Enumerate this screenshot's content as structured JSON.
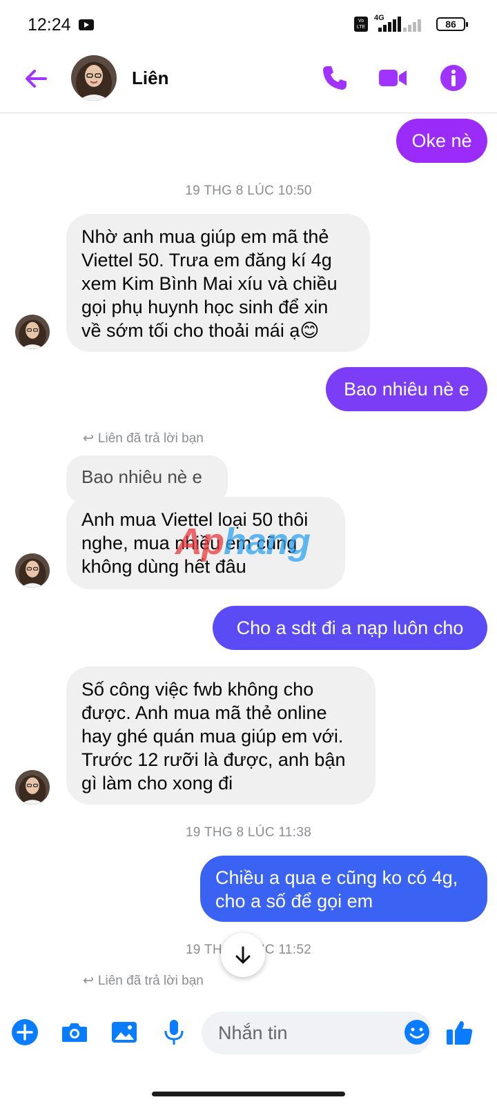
{
  "status_bar": {
    "time": "12:24",
    "network": "4G",
    "volte": "Vo LTE",
    "battery": "86"
  },
  "header": {
    "contact_name": "Liên",
    "accent_color": "#a033ff"
  },
  "messages": [
    {
      "id": "m1",
      "direction": "outgoing",
      "text": "Oke nè"
    },
    {
      "id": "ts1",
      "type": "timestamp",
      "text": "19 THG 8 LÚC 10:50"
    },
    {
      "id": "m2",
      "direction": "incoming",
      "lines": [
        "Nhờ anh mua giúp em mã thẻ",
        "Viettel 50. Trưa em đăng kí 4g",
        "xem Kim Bình Mai xíu và chiều",
        "gọi phụ huynh học sinh để xin",
        "về sớm tối cho thoải mái ạ😊"
      ]
    },
    {
      "id": "m3",
      "direction": "outgoing",
      "text": "Bao nhiêu nè e"
    },
    {
      "id": "r1",
      "type": "reply_note",
      "text": "Liên đã trả lời bạn"
    },
    {
      "id": "q1",
      "type": "quoted",
      "text": "Bao nhiêu nè e"
    },
    {
      "id": "m4",
      "direction": "incoming",
      "lines": [
        "Anh mua Viettel loại 50 thôi",
        "nghe, mua nhiều em cũng",
        "không dùng hết đâu"
      ]
    },
    {
      "id": "m5",
      "direction": "outgoing",
      "text": "Cho a sdt đi a nạp luôn cho"
    },
    {
      "id": "m6",
      "direction": "incoming",
      "lines": [
        "Số công việc fwb không cho",
        "được. Anh mua mã thẻ online",
        "hay ghé quán mua giúp em với.",
        "Trước 12 rưỡi là được, anh bận",
        "gì làm cho xong đi"
      ]
    },
    {
      "id": "ts2",
      "type": "timestamp",
      "text": "19 THG 8 LÚC 11:38"
    },
    {
      "id": "m7",
      "direction": "outgoing",
      "lines": [
        "Chiều a qua e cũng ko có 4g,",
        "cho a số để gọi em"
      ]
    },
    {
      "id": "ts3",
      "type": "timestamp",
      "text": "19 THG 8 LÚC 11:52"
    },
    {
      "id": "r2",
      "type": "reply_note",
      "text": "Liên đã trả lời bạn"
    }
  ],
  "watermark": {
    "part_a": "Ap",
    "part_b": "hang"
  },
  "composer": {
    "placeholder": "Nhắn tin"
  },
  "colors": {
    "accent_purple": "#a033ff",
    "bubble_purple": "#9b2bf9",
    "bubble_violet": "#7b3df6",
    "bubble_indigo": "#5a4bf5",
    "bubble_blue": "#3a63f3",
    "composer_blue": "#0a7cff",
    "incoming_bg": "#f0f0f0"
  }
}
